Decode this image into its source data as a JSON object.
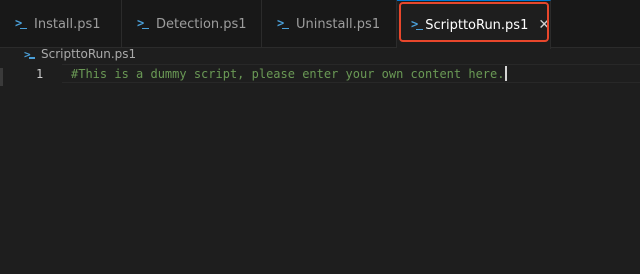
{
  "tabs": [
    {
      "label": "Install.ps1",
      "icon": "powershell-icon",
      "active": false
    },
    {
      "label": "Detection.ps1",
      "icon": "powershell-icon",
      "active": false
    },
    {
      "label": "Uninstall.ps1",
      "icon": "powershell-icon",
      "active": false
    },
    {
      "label": "ScripttoRun.ps1",
      "icon": "powershell-icon",
      "active": true,
      "close_icon": "close-icon",
      "close_glyph": "✕"
    }
  ],
  "breadcrumb": {
    "file": "ScripttoRun.ps1",
    "icon": "powershell-icon"
  },
  "editor": {
    "lines": [
      {
        "number": "1",
        "text": "#This is a dummy script, please enter your own content here."
      }
    ]
  },
  "colors": {
    "accent": "#0078d4",
    "highlight_box": "#e8472c",
    "comment": "#6a9955",
    "ps_icon": "#4a9fd8"
  }
}
